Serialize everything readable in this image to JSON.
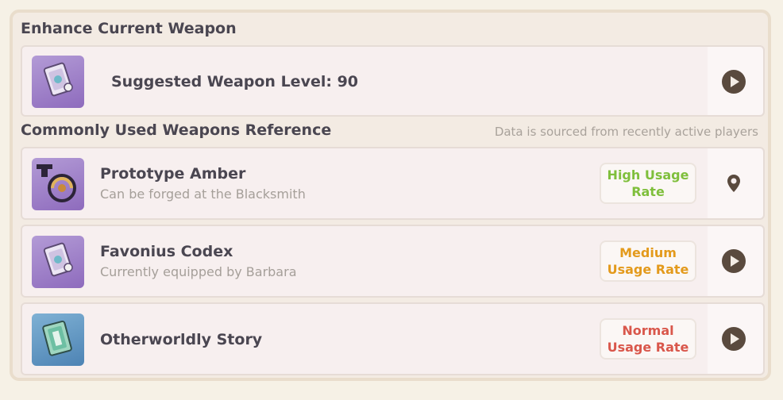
{
  "enhance_section": {
    "title": "Enhance Current Weapon",
    "suggested_level_text": "Suggested Weapon Level: 90"
  },
  "reference_section": {
    "title": "Commonly Used Weapons Reference",
    "source_note": "Data is sourced from recently active players",
    "weapons": [
      {
        "name": "Prototype Amber",
        "subtitle": "Can be forged at the Blacksmith",
        "usage_line1": "High Usage",
        "usage_line2": "Rate",
        "usage_color": "#7fbf3c",
        "action_icon": "location-pin-icon"
      },
      {
        "name": "Favonius Codex",
        "subtitle": "Currently equipped by Barbara",
        "usage_line1": "Medium",
        "usage_line2": "Usage Rate",
        "usage_color": "#e39a1c",
        "action_icon": "play-arrow-icon"
      },
      {
        "name": "Otherworldly Story",
        "subtitle": "",
        "usage_line1": "Normal",
        "usage_line2": "Usage Rate",
        "usage_color": "#d9574b",
        "action_icon": "play-arrow-icon"
      }
    ]
  },
  "colors": {
    "panel_bg": "#f3ebe3",
    "card_bg": "#f7efef",
    "action_dark": "#5a4a3e"
  }
}
